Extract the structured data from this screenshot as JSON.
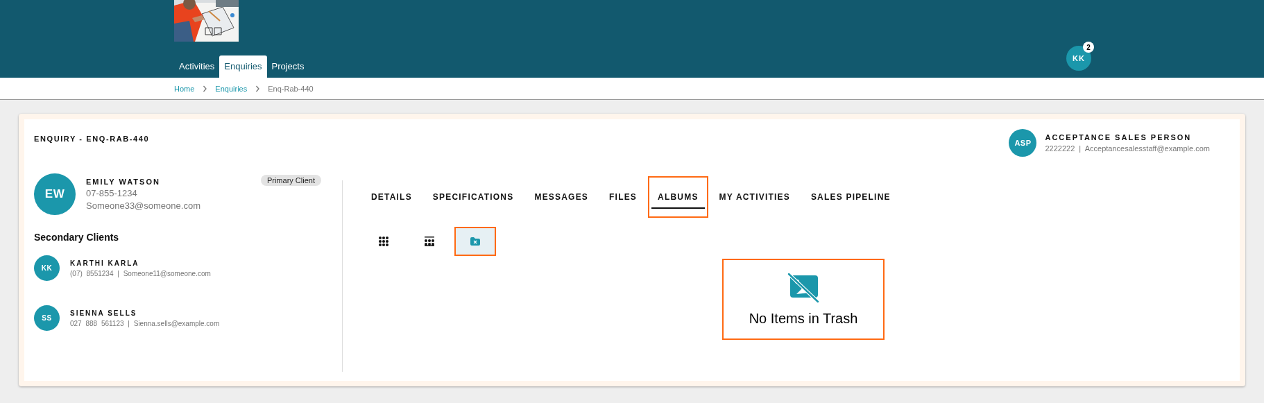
{
  "header": {
    "nav_tabs": [
      {
        "label": "Activities",
        "selected": false
      },
      {
        "label": "Enquiries",
        "selected": true
      },
      {
        "label": "Projects",
        "selected": false
      }
    ],
    "user": {
      "initials": "KK",
      "badge": "2"
    }
  },
  "breadcrumb": [
    {
      "label": "Home",
      "current": false
    },
    {
      "label": "Enquiries",
      "current": false
    },
    {
      "label": "Enq-Rab-440",
      "current": true
    }
  ],
  "enquiry": {
    "title": "ENQUIRY - ENQ-RAB-440",
    "sales_person": {
      "initials": "ASP",
      "name": "ACCEPTANCE SALES PERSON",
      "contact": "2222222 | Acceptancesalesstaff@example.com"
    },
    "primary_client": {
      "initials": "EW",
      "name": "EMILY WATSON",
      "phone": "07-855-1234",
      "email": "Someone33@someone.com",
      "tag": "Primary Client"
    },
    "secondary_heading": "Secondary Clients",
    "secondary_clients": [
      {
        "initials": "KK",
        "name": "KARTHI KARLA",
        "contact": "(07) 8551234 | Someone11@someone.com"
      },
      {
        "initials": "SS",
        "name": "SIENNA SELLS",
        "contact": "027 888 561123 | Sienna.sells@example.com"
      }
    ],
    "tabs": [
      {
        "label": "DETAILS",
        "selected": false,
        "highlighted": false
      },
      {
        "label": "SPECIFICATIONS",
        "selected": false,
        "highlighted": false
      },
      {
        "label": "MESSAGES",
        "selected": false,
        "highlighted": false
      },
      {
        "label": "FILES",
        "selected": false,
        "highlighted": false
      },
      {
        "label": "ALBUMS",
        "selected": true,
        "highlighted": true
      },
      {
        "label": "MY ACTIVITIES",
        "selected": false,
        "highlighted": false
      },
      {
        "label": "SALES PIPELINE",
        "selected": false,
        "highlighted": false
      }
    ],
    "view_buttons": [
      {
        "kind": "grid",
        "selected": false,
        "highlighted": false
      },
      {
        "kind": "list",
        "selected": false,
        "highlighted": false
      },
      {
        "kind": "trash",
        "selected": true,
        "highlighted": true
      }
    ],
    "empty_state": {
      "message": "No Items in Trash",
      "highlighted": true
    }
  }
}
